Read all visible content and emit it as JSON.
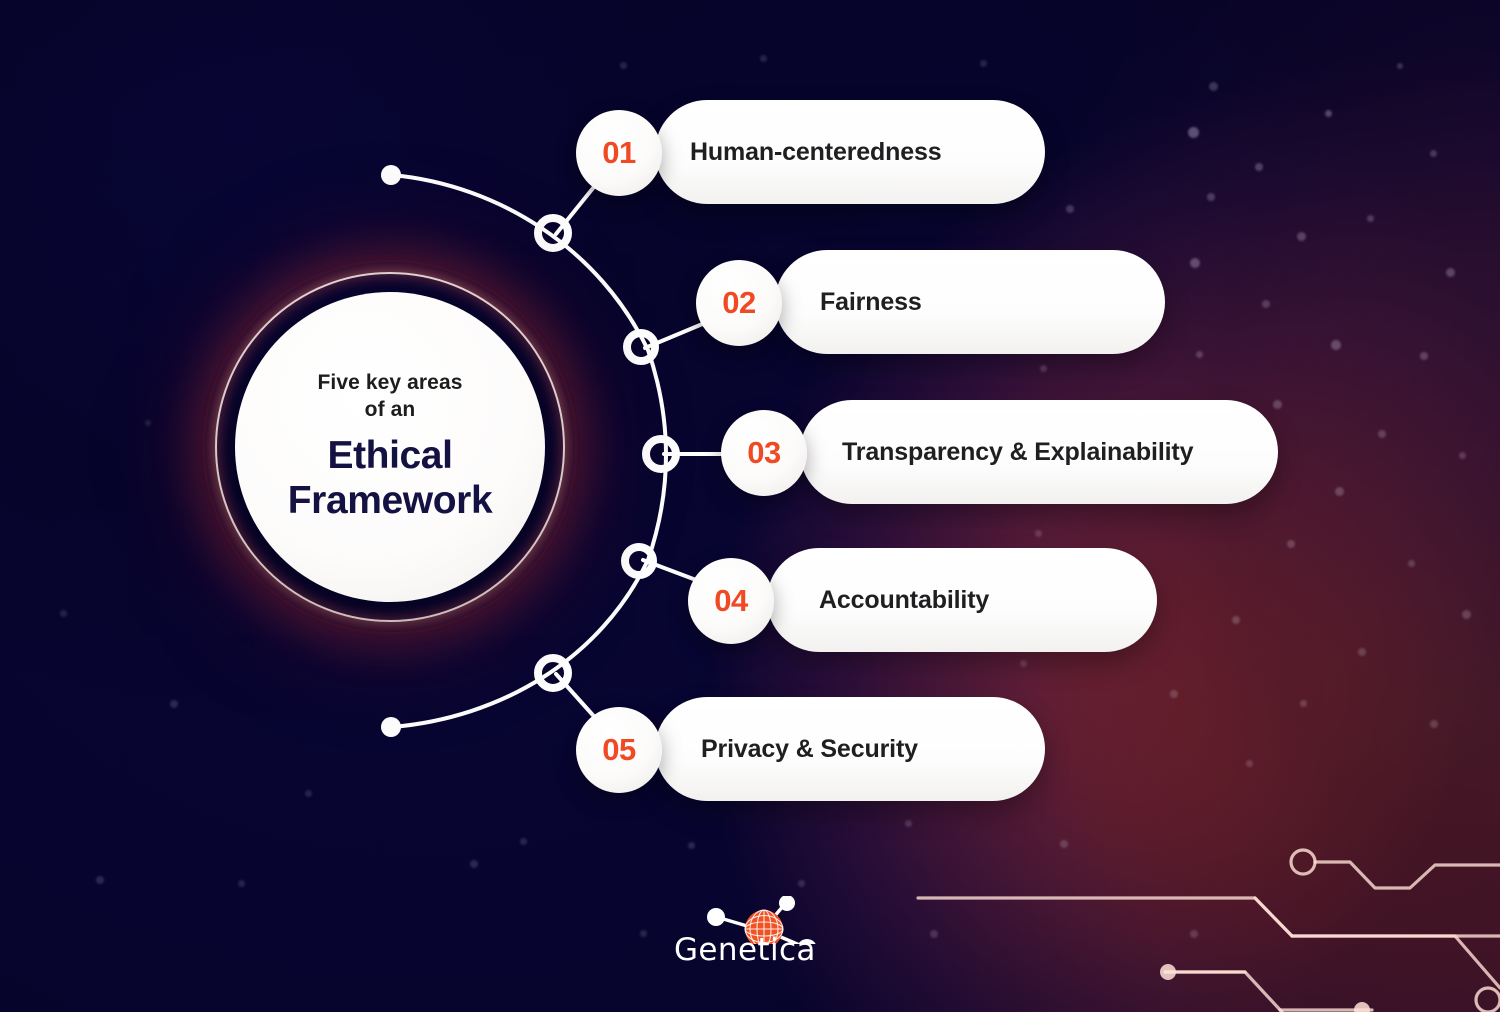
{
  "theme": {
    "background_navy": "#080533",
    "accent_orange": "#ef4a23",
    "heading_navy": "#141242",
    "pill_white": "#ffffff",
    "body_dark": "#1f1f21"
  },
  "hub": {
    "line1": "Five key areas",
    "line2": "of an",
    "title_line1": "Ethical",
    "title_line2": "Framework"
  },
  "items": [
    {
      "number": "01",
      "label": "Human-centeredness"
    },
    {
      "number": "02",
      "label": "Fairness"
    },
    {
      "number": "03",
      "label": "Transparency & Explainability"
    },
    {
      "number": "04",
      "label": "Accountability"
    },
    {
      "number": "05",
      "label": "Privacy & Security"
    }
  ],
  "logo": {
    "wordmark": "Genetica",
    "globe_icon": "orange-wireframe-globe-icon",
    "node_icon": "white-node-icon"
  },
  "decoration": {
    "circuit": "circuit-trace-decoration",
    "stars": "star-particles"
  }
}
